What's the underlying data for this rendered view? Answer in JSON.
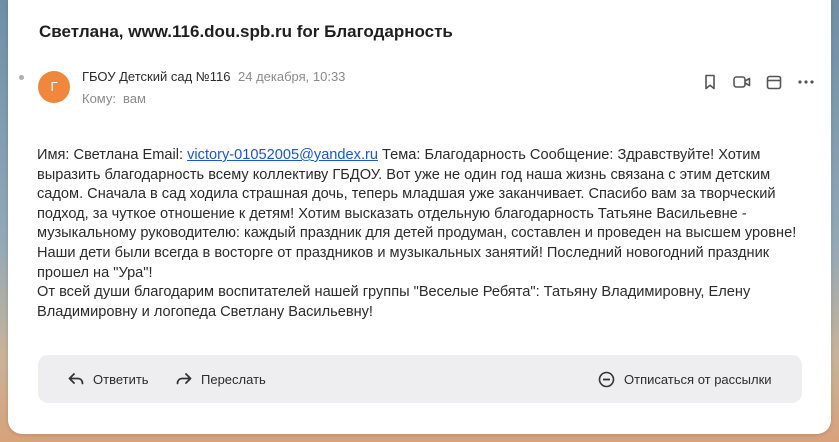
{
  "email": {
    "subject": "Светлана, www.116.dou.spb.ru for Благодарность",
    "avatar_letter": "Г",
    "avatar_color": "#f0873c",
    "sender": "ГБОУ Детский сад №116",
    "date": "24 декабря, 10:33",
    "to_label": "Кому:",
    "to_value": "вам"
  },
  "header_icons": [
    "bookmark-icon",
    "video-icon",
    "calendar-icon",
    "more-icon"
  ],
  "body": {
    "part1": "Имя: Светлана Email: ",
    "email_link": "victory-01052005@yandex.ru",
    "part2": " Тема: Благодарность Сообщение: Здравствуйте! Хотим выразить благодарность всему коллективу ГБДОУ. Вот уже не один год наша жизнь связана с этим детским садом. Сначала в сад ходила страшная дочь, теперь младшая уже заканчивает. Спасибо вам за творческий подход, за чуткое отношение к детям! Хотим высказать отдельную благодарность Татьяне Васильевне - музыкальному руководителю: каждый праздник для детей продуман, составлен и проведен на высшем уровне! Наши дети были всегда в восторге от праздников и музыкальных занятий! Последний новогодний праздник прошел на \"Ура\"!",
    "paragraph2": "От всей души благодарим воспитателей нашей группы \"Веселые Ребята\": Татьяну Владимировну, Елену Владимировну и логопеда Светлану Васильевну!"
  },
  "actions": {
    "reply": "Ответить",
    "forward": "Переслать",
    "unsubscribe": "Отписаться от рассылки"
  },
  "colors": {
    "link": "#1a56d6",
    "action_bar": "#eeeef1"
  }
}
